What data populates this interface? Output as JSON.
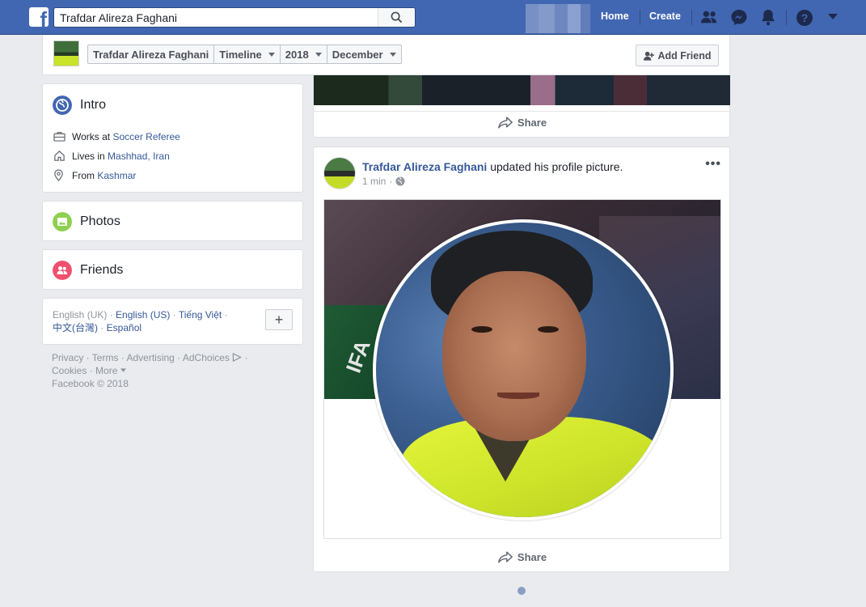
{
  "topbar": {
    "search_value": "Trafdar Alireza Faghani",
    "nav_home": "Home",
    "nav_create": "Create",
    "brand_color": "#4267b2"
  },
  "timeline_nav": {
    "crumbs": [
      "Trafdar Alireza Faghani",
      "Timeline",
      "2018",
      "December"
    ],
    "add_friend_label": "Add Friend"
  },
  "intro": {
    "title": "Intro",
    "works_prefix": "Works at ",
    "works_value": "Soccer Referee",
    "lives_prefix": "Lives in ",
    "lives_value": "Mashhad, Iran",
    "from_prefix": "From ",
    "from_value": "Kashmar"
  },
  "photos": {
    "title": "Photos"
  },
  "friends": {
    "title": "Friends"
  },
  "languages": {
    "current": "English (UK)",
    "sep": " · ",
    "options": [
      "English (US)",
      "Tiếng Việt",
      "中文(台灣)",
      "Español"
    ],
    "add_label": "+"
  },
  "footer": {
    "links": [
      "Privacy",
      "Terms",
      "Advertising",
      "AdChoices",
      "Cookies",
      "More"
    ],
    "copyright": "Facebook © 2018"
  },
  "prev_post": {
    "share_label": "Share"
  },
  "post": {
    "author": "Trafdar Alireza Faghani",
    "action": " updated his profile picture.",
    "time": "1 min",
    "cover_text": "IFA",
    "share_label": "Share"
  }
}
